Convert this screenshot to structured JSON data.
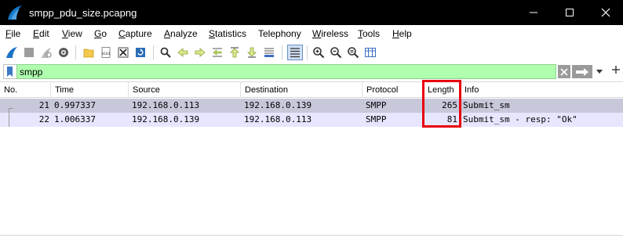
{
  "window": {
    "title": "smpp_pdu_size.pcapng"
  },
  "menu": [
    {
      "label": "File",
      "accel": "F",
      "rest": "ile"
    },
    {
      "label": "Edit",
      "accel": "E",
      "rest": "dit"
    },
    {
      "label": "View",
      "accel": "V",
      "rest": "iew"
    },
    {
      "label": "Go",
      "accel": "G",
      "rest": "o"
    },
    {
      "label": "Capture",
      "accel": "C",
      "rest": "apture"
    },
    {
      "label": "Analyze",
      "accel": "A",
      "rest": "nalyze"
    },
    {
      "label": "Statistics",
      "accel": "S",
      "rest": "tatistics"
    },
    {
      "label": "Telephony",
      "accel": "",
      "rest": "Telephony"
    },
    {
      "label": "Wireless",
      "accel": "W",
      "rest": "ireless"
    },
    {
      "label": "Tools",
      "accel": "T",
      "rest": "ools"
    },
    {
      "label": "Help",
      "accel": "H",
      "rest": "elp"
    }
  ],
  "filter": {
    "value": "smpp",
    "background": "#afffaf"
  },
  "columns": [
    "No.",
    "Time",
    "Source",
    "Destination",
    "Protocol",
    "Length",
    "Info"
  ],
  "packets": [
    {
      "no": "21",
      "time": "0.997337",
      "source": "192.168.0.113",
      "destination": "192.168.0.139",
      "protocol": "SMPP",
      "length": "265",
      "info": "Submit_sm"
    },
    {
      "no": "22",
      "time": "1.006337",
      "source": "192.168.0.139",
      "destination": "192.168.0.113",
      "protocol": "SMPP",
      "length": "81",
      "info": "Submit_sm - resp: \"Ok\""
    }
  ],
  "colors": {
    "selected_row": "#c8c8db",
    "related_row": "#e7e6ff",
    "highlight_box": "#e8000b"
  }
}
